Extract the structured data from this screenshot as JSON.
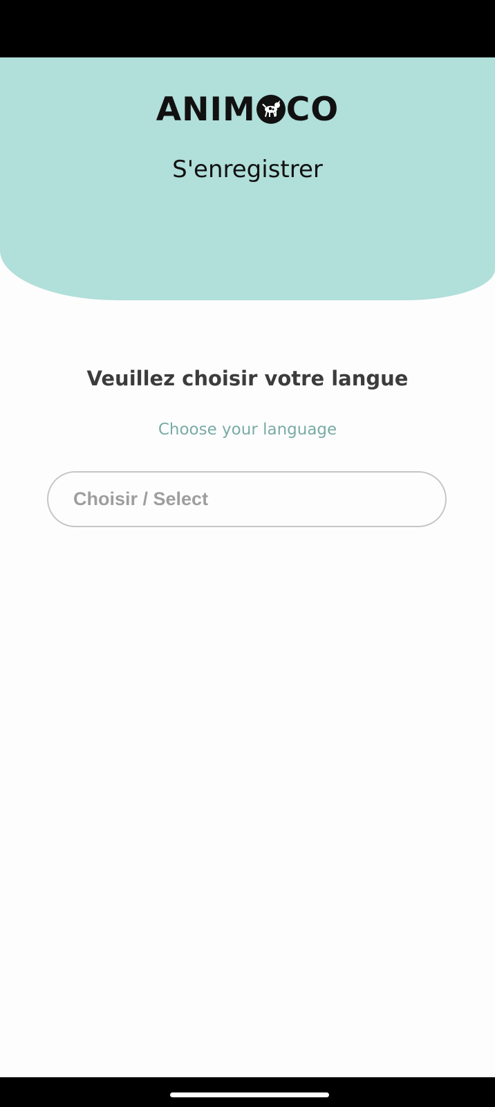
{
  "colors": {
    "header_background": "#b1dfda",
    "accent_text": "#79aba5",
    "title_text": "#3c3c3c",
    "select_border": "#c6c6c6",
    "placeholder_text": "#9e9e9e",
    "system_bars": "#000000"
  },
  "header": {
    "logo_part1": "ANIM",
    "logo_icon": "dog-in-circle-icon",
    "logo_part2": "CO",
    "title": "S'enregistrer"
  },
  "main": {
    "prompt_title": "Veuillez choisir votre langue",
    "prompt_subtitle": "Choose your language",
    "language_select": {
      "placeholder": "Choisir / Select"
    }
  },
  "system": {
    "home_indicator": "home-indicator"
  }
}
